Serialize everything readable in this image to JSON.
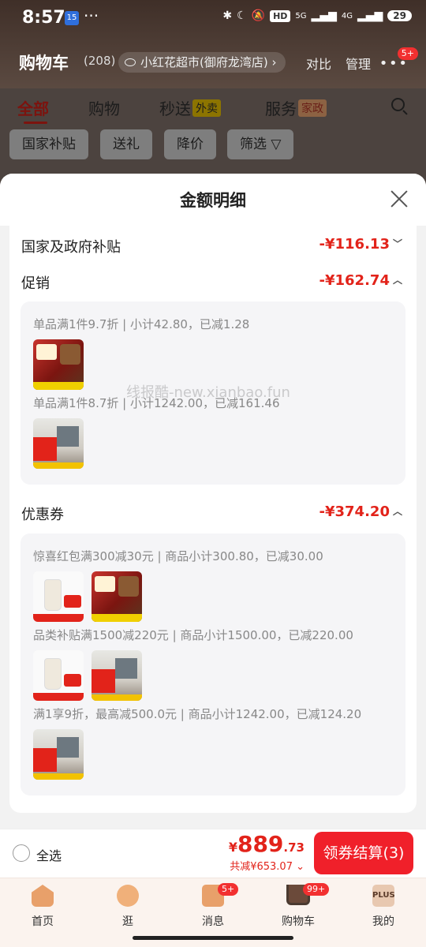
{
  "status_bar": {
    "time": "8:57",
    "calendar_day": "15",
    "dots": "···",
    "hd": "HD",
    "network": "5G",
    "network2": "4G",
    "battery": "29"
  },
  "header": {
    "title": "购物车",
    "count": "(208)",
    "store": "小红花超市(御府龙湾店) ›",
    "compare": "对比",
    "manage": "管理",
    "more_badge": "5+"
  },
  "tabs": [
    {
      "label": "全部",
      "active": true
    },
    {
      "label": "购物"
    },
    {
      "label": "秒送",
      "tag": "外卖"
    },
    {
      "label": "服务",
      "tag": "家政"
    }
  ],
  "chips": [
    "国家补贴",
    "送礼",
    "降价",
    "筛选 ▽"
  ],
  "sheet": {
    "title": "金额明细",
    "gov_subsidy": {
      "label": "国家及政府补贴",
      "amount": "-¥116.13"
    },
    "promo": {
      "label": "促销",
      "amount": "-¥162.74",
      "lines": [
        "单品满1件9.7折 | 小计42.80，已减1.28",
        "单品满1件8.7折 | 小计1242.00，已减161.46"
      ]
    },
    "coupon": {
      "label": "优惠券",
      "amount": "-¥374.20",
      "lines": [
        "惊喜红包满300减30元 | 商品小计300.80，已减30.00",
        "品类补贴满1500减220元 | 商品小计1500.00，已减220.00",
        "满1享9折，最高减500.0元 | 商品小计1242.00，已减124.20"
      ]
    }
  },
  "watermark": "线报酷-new.xianbao.fun",
  "bottom": {
    "select_all": "全选",
    "currency": "¥",
    "price_int": "889",
    "price_dec": ".73",
    "saved": "共减¥653.07 ⌄",
    "checkout": "领券结算(3)"
  },
  "tabbar": [
    {
      "label": "首页",
      "icon": "home-icon"
    },
    {
      "label": "逛",
      "icon": "browse-icon"
    },
    {
      "label": "消息",
      "icon": "message-icon",
      "badge": "5+"
    },
    {
      "label": "购物车",
      "icon": "cart-icon",
      "badge": "99+"
    },
    {
      "label": "我的",
      "icon": "plus-icon",
      "icon_text": "PLUS"
    }
  ],
  "colors": {
    "accent": "#e2231a",
    "header_bg": "#4a3a32"
  }
}
